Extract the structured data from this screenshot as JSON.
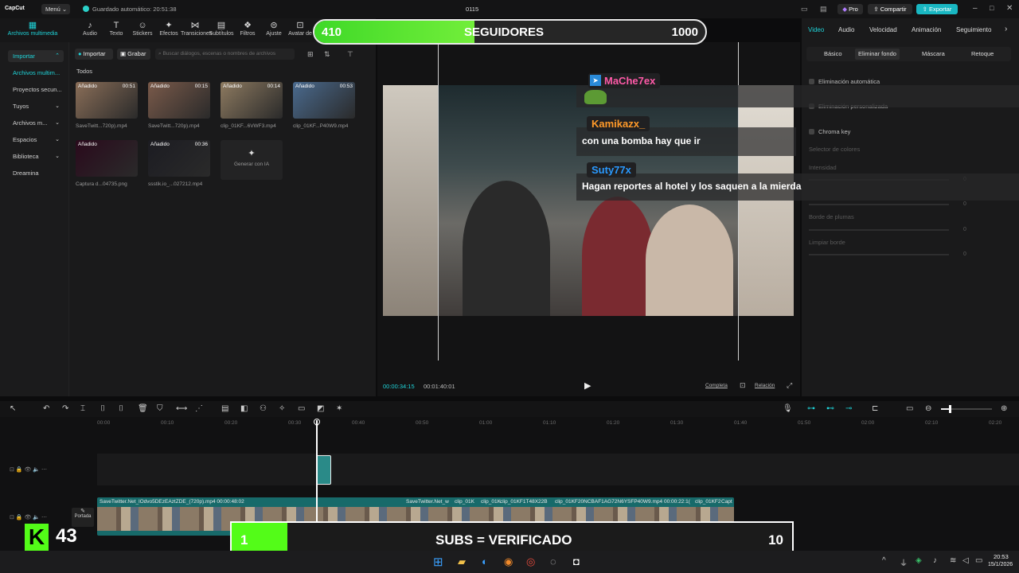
{
  "titlebar": {
    "app": "CapCut",
    "menu": "Menú",
    "autosave": "Guardado automático: 20:51:38",
    "project": "0115",
    "pro": "Pro",
    "share": "Compartir",
    "export": "Exportar"
  },
  "toolbar": [
    {
      "label": "Archivos multimedia",
      "icon": "media-icon",
      "active": true
    },
    {
      "label": "Audio",
      "icon": "audio-icon"
    },
    {
      "label": "Texto",
      "icon": "text-icon"
    },
    {
      "label": "Stickers",
      "icon": "sticker-icon"
    },
    {
      "label": "Efectos",
      "icon": "effects-icon"
    },
    {
      "label": "Transiciones",
      "icon": "transition-icon"
    },
    {
      "label": "Subtítulos",
      "icon": "subtitle-icon"
    },
    {
      "label": "Filtros",
      "icon": "filter-icon"
    },
    {
      "label": "Ajuste",
      "icon": "adjust-icon"
    },
    {
      "label": "Avatar de",
      "icon": "avatar-icon"
    }
  ],
  "sidebar": [
    {
      "label": "Importar",
      "selected": true,
      "chev": "⌃"
    },
    {
      "label": "Archivos multim...",
      "accent": true
    },
    {
      "label": "Proyectos secun..."
    },
    {
      "label": "Tuyos",
      "chev": "⌄"
    },
    {
      "label": "Archivos m...",
      "chev": "⌄"
    },
    {
      "label": "Espacios",
      "chev": "⌄"
    },
    {
      "label": "Biblioteca",
      "chev": "⌄"
    },
    {
      "label": "Dreamina"
    }
  ],
  "media_bar": {
    "import": "Importar",
    "record": "Grabar",
    "search_placeholder": "Buscar diálogos, escenas o nombres de archivos",
    "filter": "Todos"
  },
  "media_items": [
    {
      "name": "SaveTwitt...720p).mp4",
      "badge": "Añadido",
      "dur": "00:51",
      "color": "#8a6e58"
    },
    {
      "name": "SaveTwitt...720p).mp4",
      "badge": "Añadido",
      "dur": "00:15",
      "color": "#7a5a4a"
    },
    {
      "name": "clip_01KF...6VWF3.mp4",
      "badge": "Añadido",
      "dur": "00:14",
      "color": "#8d7a60"
    },
    {
      "name": "clip_01KF...P40W9.mp4",
      "badge": "Añadido",
      "dur": "00:53",
      "color": "#4a6a8e"
    },
    {
      "name": "Captura d...04735.png",
      "badge": "Añadido",
      "dur": "",
      "color": "#2a0a1c"
    },
    {
      "name": "ssstik.io_...027212.mp4",
      "badge": "Añadido",
      "dur": "00:36",
      "color": "#1c1c22"
    }
  ],
  "generate_ai": "Generar con IA",
  "player": {
    "current": "00:00:34:15",
    "total": "00:01:40:01",
    "full": "Completa",
    "ratio": "Relación"
  },
  "overlay_followers": {
    "current": "410",
    "label": "SEGUIDORES",
    "goal": "1000",
    "progress": 0.41
  },
  "chat": [
    {
      "user": "MaChe7ex",
      "color": "#ff5aa8",
      "msg": ""
    },
    {
      "user": "Kamikazx_",
      "color": "#ff9a2a",
      "msg": "con una bomba hay que ir"
    },
    {
      "user": "Suty77x",
      "color": "#2a9aff",
      "msg": "Hagan reportes al hotel y los saquen a la mierda"
    }
  ],
  "right_tabs": [
    "Video",
    "Audio",
    "Velocidad",
    "Animación",
    "Seguimiento"
  ],
  "right_subtabs": [
    "Básico",
    "Eliminar fondo",
    "Máscara",
    "Retoque"
  ],
  "right_rows": [
    "Eliminación automática",
    "Eliminación personalizada",
    "Chroma key",
    "Selector de colores",
    "Intensidad",
    "Borde de plumas",
    "Limpiar borde"
  ],
  "right_values": [
    "0",
    "0",
    "0",
    "0"
  ],
  "timeline_ticks": [
    "00:00",
    "00:10",
    "00:20",
    "00:30",
    "00:40",
    "00:50",
    "01:00",
    "01:10",
    "01:20",
    "01:30",
    "01:40",
    "01:50",
    "02:00",
    "02:10",
    "02:20"
  ],
  "clips": [
    {
      "label": "SaveTwitter.Net_lOdvo5DEzEAztZDE_(720p).mp4  00:00:48:02"
    },
    {
      "label": "SaveTwitter.Net_w"
    },
    {
      "label": "clip_01K"
    },
    {
      "label": "clip_01K"
    },
    {
      "label": "clip_01KF1T48X22B"
    },
    {
      "label": "clip_01KF20NCBAF1AG72N6YSFP40W9.mp4"
    },
    {
      "label": "00:00:22:1("
    },
    {
      "label": "clip_01KF2"
    },
    {
      "label": "Capt"
    }
  ],
  "cover_label": "Portada",
  "kick": {
    "logo": "K",
    "count": "43"
  },
  "subs": {
    "current": "1",
    "label": "SUBS = VERIFICADO",
    "goal": "10",
    "progress": 0.1
  },
  "clock": {
    "time": "20:53",
    "date": "15/1/2026"
  }
}
